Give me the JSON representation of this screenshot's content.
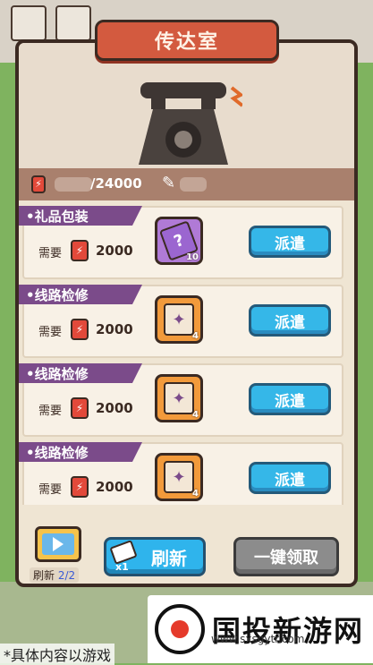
{
  "panel": {
    "title": "传达室",
    "energy_total": "/24000",
    "energy_icon": "energy-can-icon",
    "feather_icon": "quill-icon"
  },
  "tasks": [
    {
      "name": "•礼品包装",
      "need_label": "需要",
      "need_value": "2000",
      "reward_icon": "mystery-card-icon",
      "reward_count": "10",
      "button": "派遣",
      "reward_color": "#b07ad6"
    },
    {
      "name": "•线路检修",
      "need_label": "需要",
      "need_value": "2000",
      "reward_icon": "map-card-icon",
      "reward_count": "4",
      "button": "派遣",
      "reward_color": "#f29a3b"
    },
    {
      "name": "•线路检修",
      "need_label": "需要",
      "need_value": "2000",
      "reward_icon": "map-card-icon",
      "reward_count": "4",
      "button": "派遣",
      "reward_color": "#f29a3b"
    },
    {
      "name": "•线路检修",
      "need_label": "需要",
      "need_value": "2000",
      "reward_icon": "map-card-icon",
      "reward_count": "4",
      "button": "派遣",
      "reward_color": "#f29a3b"
    }
  ],
  "bottom": {
    "refresh_count_label": "刷新",
    "refresh_count": "2/2",
    "refresh_button": "刷新",
    "refresh_cost": "x1",
    "collect_all_button": "一键领取"
  },
  "watermark": {
    "text": "国投新游网",
    "url": "www.sxsgytr.com",
    "disclaimer": "*具体内容以游戏"
  }
}
